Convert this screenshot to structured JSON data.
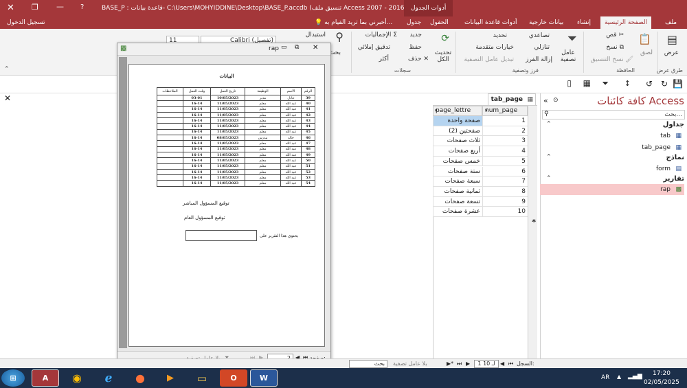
{
  "titlebar": {
    "title": "BASE_P : قاعدة بيانات- C:\\Users\\MOHYIDDINE\\Desktop\\BASE_P.accdb (تنسيق ملف Access 2007 - 2016) ...",
    "tools": "أدوات الجدول",
    "help": "?",
    "signin": "تسجيل الدخول"
  },
  "tabs": [
    "ملف",
    "الصفحة الرئيسية",
    "إنشاء",
    "بيانات خارجية",
    "أدوات قاعدة البيانات",
    "الحقول",
    "جدول"
  ],
  "tellme": "أخبرني بما تريد القيام به...",
  "ribbon": {
    "view": "عرض",
    "views_group": "طرق عرض",
    "cut": "قص",
    "copy": "نسخ",
    "paste": "لصق",
    "format_painter": "نسخ التنسيق",
    "clipboard_group": "الحافظة",
    "filter": "عامل تصفية",
    "ascending": "تصاعدي",
    "descending": "تنازلي",
    "remove_sort": "إزالة الفرز",
    "selection": "تحديد",
    "advanced": "خيارات متقدمة",
    "toggle_filter": "تبديل عامل التصفية",
    "sortfilter_group": "فرز وتصفية",
    "refresh": "تحديث الكل",
    "new": "جديد",
    "save": "حفظ",
    "delete": "حذف",
    "totals": "الإجماليات",
    "spelling": "تدقيق إملائي",
    "more": "أكثر",
    "records_group": "سجلات",
    "replace": "استبدال",
    "find": "بحث",
    "font": "Calibri (تفصيل)",
    "fontsize": "11"
  },
  "nav": {
    "title": "كافة كائنات Access",
    "search_placeholder": "بحث...",
    "groups": [
      {
        "name": "جداول",
        "items": [
          "tab",
          "tab_page"
        ]
      },
      {
        "name": "نماذج",
        "items": [
          "form"
        ]
      },
      {
        "name": "تقارير",
        "items": [
          "rap"
        ]
      }
    ]
  },
  "datasheet": {
    "tab_label": "tab_page",
    "headers": [
      "num_page",
      "page_lettre"
    ],
    "rows": [
      [
        "1",
        "صفحة واحدة"
      ],
      [
        "2",
        "صفحتين (2)"
      ],
      [
        "3",
        "ثلاث صفحات"
      ],
      [
        "4",
        "أربع صفحات"
      ],
      [
        "5",
        "خمس صفحات"
      ],
      [
        "6",
        "ستة صفحات"
      ],
      [
        "7",
        "سبعة صفحات"
      ],
      [
        "8",
        "ثمانية صفحات"
      ],
      [
        "9",
        "تسعة صفحات"
      ],
      [
        "10",
        "عشرة صفحات"
      ]
    ],
    "new_row": "*"
  },
  "report": {
    "window_title": "rap",
    "heading": "البيانات",
    "columns": [
      "الرقم",
      "الاسم",
      "الوظيفة",
      "تاريخ العمل",
      "وقت العمل",
      "الملاحظات"
    ],
    "rows": [
      [
        "39",
        "عادل",
        "مدير",
        "10/05/2023",
        "03-01",
        ""
      ],
      [
        "40",
        "عبد الله",
        "معلم",
        "11/05/2023",
        "16-14",
        ""
      ],
      [
        "41",
        "عبد الله",
        "معلم",
        "11/05/2023",
        "16-14",
        ""
      ],
      [
        "42",
        "عبد الله",
        "معلم",
        "11/05/2023",
        "16-14",
        ""
      ],
      [
        "43",
        "عبد الله",
        "معلم",
        "11/05/2023",
        "16-14",
        ""
      ],
      [
        "44",
        "عبد الله",
        "معلم",
        "11/05/2023",
        "16-14",
        ""
      ],
      [
        "45",
        "عبد الله",
        "معلم",
        "11/05/2023",
        "16-14",
        ""
      ],
      [
        "46",
        "خالد",
        "مدرس",
        "08/05/2023",
        "16-14",
        ""
      ],
      [
        "47",
        "عبد الله",
        "معلم",
        "11/05/2023",
        "16-14",
        ""
      ],
      [
        "48",
        "عبد الله",
        "معلم",
        "11/05/2023",
        "16-14",
        ""
      ],
      [
        "49",
        "عبد الله",
        "معلم",
        "11/05/2023",
        "16-14",
        ""
      ],
      [
        "50",
        "عبد الله",
        "معلم",
        "11/05/2023",
        "16-14",
        ""
      ],
      [
        "51",
        "عبد الله",
        "معلم",
        "11/05/2023",
        "16-14",
        ""
      ],
      [
        "52",
        "عبد الله",
        "معلم",
        "11/05/2023",
        "16-14",
        ""
      ],
      [
        "53",
        "عبد الله",
        "معلم",
        "11/05/2023",
        "16-14",
        ""
      ],
      [
        "54",
        "عبد الله",
        "معلم",
        "11/05/2023",
        "16-14",
        ""
      ]
    ],
    "sign1": "توقيع المسؤول المباشر",
    "sign2": "توقيع المسؤول العام",
    "contains": "يحتوي هذا التقرير على",
    "page_label": "صفحة:",
    "page_value": "2",
    "no_filter": "بلا عامل تصفية"
  },
  "status": {
    "record": "السجل:",
    "record_value": "1 لـ 10",
    "no_filter": "بلا عامل تصفية",
    "search": "بحث"
  },
  "taskbar": {
    "lang": "AR",
    "time": "17:20",
    "date": "02/05/2025"
  }
}
